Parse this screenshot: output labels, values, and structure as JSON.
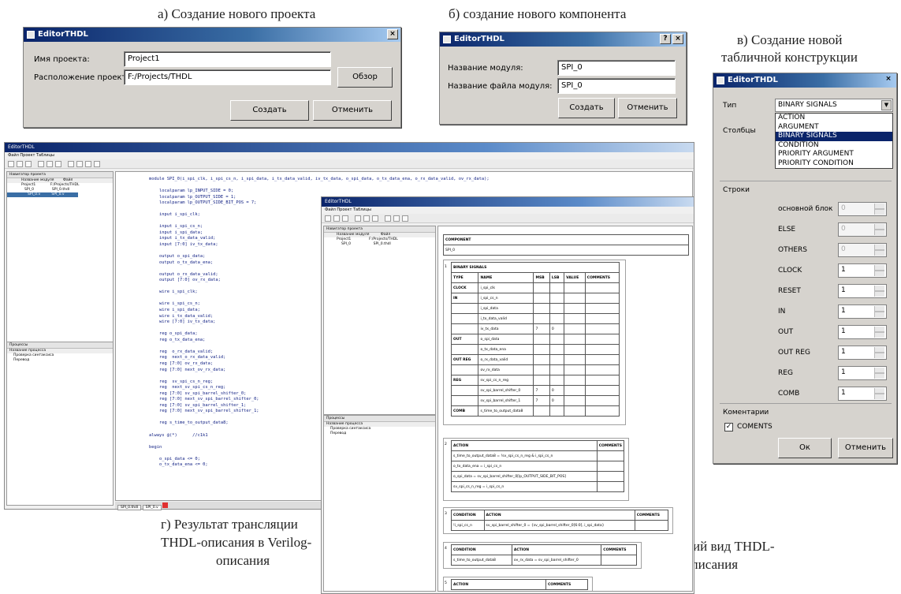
{
  "captions": {
    "a": "а) Создание нового проекта",
    "b": "б) создание нового компонента",
    "c1": "в) Создание новой",
    "c2": "табличной конструкции",
    "d1": "г) Результат трансляции",
    "d2": "THDL-описания в Verilog-",
    "d3": "описания",
    "e1": "г) Внешний вид THDL-",
    "e2": "описания"
  },
  "dialog_a": {
    "title": "EditorTHDL",
    "close": "×",
    "name_label": "Имя проекта:",
    "name_value": "Project1",
    "path_label": "Расположение проекта:",
    "path_value": "F:/Projects/THDL",
    "browse": "Обзор",
    "create": "Создать",
    "cancel": "Отменить"
  },
  "dialog_b": {
    "title": "EditorTHDL",
    "help": "?",
    "close": "×",
    "module_label": "Название модуля:",
    "module_value": "SPI_0",
    "file_label": "Название файла модуля:",
    "file_value": "SPI_0",
    "create": "Создать",
    "cancel": "Отменить"
  },
  "dialog_c": {
    "title": "EditorTHDL",
    "close": "×",
    "type_label": "Тип",
    "type_value": "BINARY SIGNALS",
    "options": [
      "ACTION",
      "ARGUMENT",
      "BINARY SIGNALS",
      "CONDITION",
      "PRIORITY ARGUMENT",
      "PRIORITY CONDITION"
    ],
    "columns_label": "Столбцы",
    "rows_label": "Строки",
    "rows": [
      {
        "label": "основной блок",
        "value": "0"
      },
      {
        "label": "ELSE",
        "value": "0"
      },
      {
        "label": "OTHERS",
        "value": "0"
      },
      {
        "label": "CLOCK",
        "value": "1"
      },
      {
        "label": "RESET",
        "value": "1"
      },
      {
        "label": "IN",
        "value": "1"
      },
      {
        "label": "OUT",
        "value": "1"
      },
      {
        "label": "OUT REG",
        "value": "1"
      },
      {
        "label": "REG",
        "value": "1"
      },
      {
        "label": "COMB",
        "value": "1"
      }
    ],
    "comments_label": "Коментарии",
    "comments_check": "COMENTS",
    "ok": "Ок",
    "cancel": "Отменить"
  },
  "main_window": {
    "title": "EditorTHDL",
    "menu": "Файл  Проект  Таблицы",
    "nav_title": "Навигатор проекта",
    "nav_cols": [
      "Название модуля",
      "Файл"
    ],
    "nav_rows": [
      [
        "Project1",
        "F:/Projects/THDL"
      ],
      [
        "SPI_0",
        "SPI_0.thdl"
      ],
      [
        "SPI_0.v",
        "SPI_0.v"
      ]
    ],
    "proc_title": "Процессы",
    "proc_col": "Название процесса",
    "proc_rows": [
      "Проверка синтаксиса",
      "Перевод"
    ],
    "tabs": [
      "SPI_0.thdl",
      "SPI_0.v"
    ],
    "code": "module SPI_0(i_spi_clk, i_spi_cs_n, i_spi_data, i_tx_data_valid, iv_tx_data, o_spi_data, o_tx_data_ena, o_rx_data_valid, ov_rx_data);\n\n    localparam lp_INPUT_SIDE = 0;\n    localparam lp_OUTPUT_SIDE = 1;\n    localparam lp_OUTPUT_SIDE_BIT_POS = 7;\n\n    input i_spi_clk;\n\n    input i_spi_cs_n;\n    input i_spi_data;\n    input i_tx_data_valid;\n    input [7:0] iv_tx_data;\n\n    output o_spi_data;\n    output o_tx_data_ena;\n\n    output o_rx_data_valid;\n    output [7:0] ov_rx_data;\n\n    wire i_spi_clk;\n\n    wire i_spi_cs_n;\n    wire i_spi_data;\n    wire i_tx_data_valid;\n    wire [7:0] iv_tx_data;\n\n    reg o_spi_data;\n    reg o_tx_data_ena;\n\n    reg  o_rx_data_valid;\n    reg  next_o_rx_data_valid;\n    reg [7:0] ov_rx_data;\n    reg [7:0] next_ov_rx_data;\n\n    reg  sv_spi_cs_n_reg;\n    reg  next_sv_spi_cs_n_reg;\n    reg [7:0] sv_spi_barrel_shifter_0;\n    reg [7:0] next_sv_spi_barrel_shifter_0;\n    reg [7:0] sv_spi_barrel_shifter_1;\n    reg [7:0] next_sv_spi_barrel_shifter_1;\n\n    reg s_time_to_output_data8;\n\nalways @(*)      //c1k1\n\nbegin\n\n    o_spi_data <= 0;\n    o_tx_data_ena <= 0;"
  },
  "second_window": {
    "title": "EditorTHDL",
    "menu": "Файл  Проект  Таблицы",
    "nav_title": "Навигатор проекта",
    "nav_cols": [
      "Название модуля",
      "Файл"
    ],
    "nav_rows": [
      [
        "Project1",
        "F:/Projects/THDL"
      ],
      [
        "SPI_0",
        "SPI_0.thdl"
      ]
    ],
    "proc_title": "Процессы",
    "proc_col": "Название процесса",
    "proc_rows": [
      "Проверка синтаксиса",
      "Перевод"
    ],
    "component_label": "COMPONENT",
    "component_value": "SPI_0",
    "bs_num": "1",
    "bs_title": "BINARY SIGNALS",
    "bs_cols": [
      "TYPE",
      "NAME",
      "MSB",
      "LSB",
      "VALUE",
      "COMMENTS"
    ],
    "bs_rows": [
      [
        "CLOCK",
        "i_spi_clk",
        "",
        ""
      ],
      [
        "IN",
        "i_spi_cs_n",
        "",
        ""
      ],
      [
        "",
        "i_spi_data",
        "",
        ""
      ],
      [
        "",
        "i_tx_data_valid",
        "",
        ""
      ],
      [
        "",
        "iv_tx_data",
        "7",
        "0"
      ],
      [
        "OUT",
        "o_spi_data",
        "",
        ""
      ],
      [
        "",
        "o_tx_data_ena",
        "",
        ""
      ],
      [
        "OUT REG",
        "o_rx_data_valid",
        "",
        ""
      ],
      [
        "",
        "ov_rx_data",
        "",
        ""
      ],
      [
        "REG",
        "sv_spi_cs_n_reg",
        "",
        ""
      ],
      [
        "",
        "sv_spi_barrel_shifter_0",
        "7",
        "0"
      ],
      [
        "",
        "sv_spi_barrel_shifter_1",
        "7",
        "0"
      ],
      [
        "COMB",
        "s_time_to_output_data8",
        "",
        ""
      ]
    ],
    "act_num": "2",
    "act_cols": [
      "ACTION",
      "COMMENTS"
    ],
    "act_rows": [
      "s_time_to_output_data8  =  !sv_spi_cs_n_reg & i_spi_cs_n",
      "o_tx_data_ena  =  i_spi_cs_n",
      "o_spi_data  =  sv_spi_barrel_shifter_0[lp_OUTPUT_SIDE_BIT_POS]",
      "sv_spi_cs_n_reg = i_spi_cs_n"
    ],
    "t3_num": "3",
    "t3_cols": [
      "CONDITION",
      "ACTION",
      "COMMENTS"
    ],
    "t3_row": [
      "!i_spi_cs_n",
      "sv_spi_barrel_shifter_0 = {sv_spi_barrel_shifter_0[6:0], i_spi_data}"
    ],
    "t4_num": "4",
    "t4_cols": [
      "CONDITION",
      "ACTION",
      "COMMENTS"
    ],
    "t4_row": [
      "s_time_to_output_data8",
      "ov_rx_data = sv_spi_barrel_shifter_0"
    ],
    "t5_num": "5",
    "t5_cols": [
      "ACTION",
      "COMMENTS"
    ],
    "tab": "SPI_0.thdl"
  }
}
